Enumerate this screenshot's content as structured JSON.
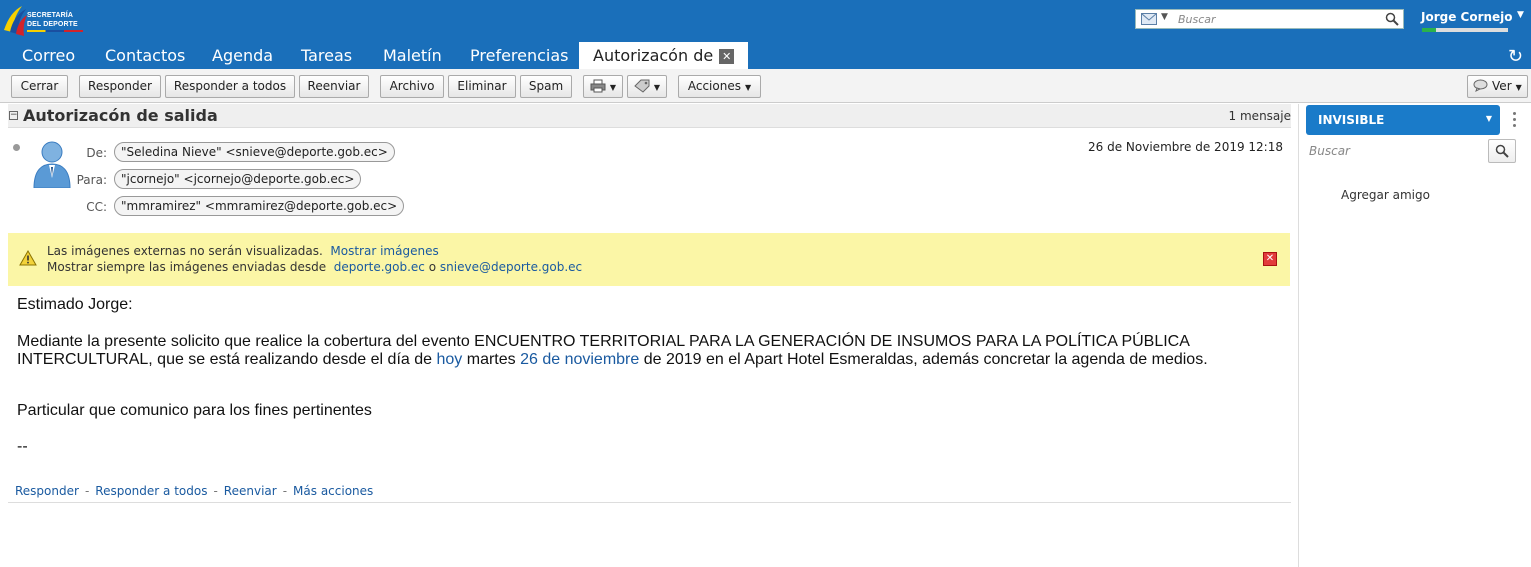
{
  "header": {
    "logo_line1": "SECRETARÍA",
    "logo_line2": "DEL DEPORTE",
    "search_placeholder": "Buscar",
    "user_name": "Jorge Cornejo",
    "user_quota_fraction": 0.16
  },
  "tabs": [
    {
      "label": "Correo"
    },
    {
      "label": "Contactos"
    },
    {
      "label": "Agenda"
    },
    {
      "label": "Tareas"
    },
    {
      "label": "Maletín"
    },
    {
      "label": "Preferencias"
    },
    {
      "label": "Autorizacón de",
      "active": true
    }
  ],
  "toolbar": {
    "close": "Cerrar",
    "reply": "Responder",
    "reply_all": "Responder a todos",
    "forward": "Reenviar",
    "archive": "Archivo",
    "delete": "Eliminar",
    "spam": "Spam",
    "actions": "Acciones",
    "view": "Ver"
  },
  "message": {
    "subject": "Autorizacón de salida",
    "count": "1 mensaje",
    "from_label": "De:",
    "to_label": "Para:",
    "cc_label": "CC:",
    "from": "\"Seledina Nieve\" <snieve@deporte.gob.ec>",
    "to": "\"jcornejo\" <jcornejo@deporte.gob.ec>",
    "cc": "\"mmramirez\" <mmramirez@deporte.gob.ec>",
    "date": "26 de Noviembre de 2019 12:18"
  },
  "warning": {
    "line1": "Las imágenes externas no serán visualizadas.",
    "show_images": "Mostrar imágenes",
    "line2": "Mostrar siempre las imágenes enviadas desde",
    "domain": "deporte.gob.ec",
    "or": "o",
    "sender": "snieve@deporte.gob.ec"
  },
  "body": {
    "greeting": "Estimado Jorge:",
    "p1_line1": "Mediante la presente solicito que realice la cobertura del evento ENCUENTRO TERRITORIAL PARA LA GENERACIÓN DE INSUMOS PARA LA POLÍTICA PÚBLICA",
    "p1_line2_a": "INTERCULTURAL, que se está realizando desde el día de",
    "p1_link1": "hoy",
    "p1_line2_b": "martes",
    "p1_link2": "26 de noviembre",
    "p1_line2_c": "de 2019 en el Apart Hotel Esmeraldas, además concretar la agenda de medios.",
    "p2": "Particular que comunico para los fines pertinentes",
    "signature": "--"
  },
  "footer_actions": {
    "reply": "Responder",
    "reply_all": "Responder a todos",
    "forward": "Reenviar",
    "more": "Más acciones",
    "separator": "-"
  },
  "right_panel": {
    "status": "INVISIBLE",
    "search_placeholder": "Buscar",
    "add_friend": "Agregar amigo"
  }
}
